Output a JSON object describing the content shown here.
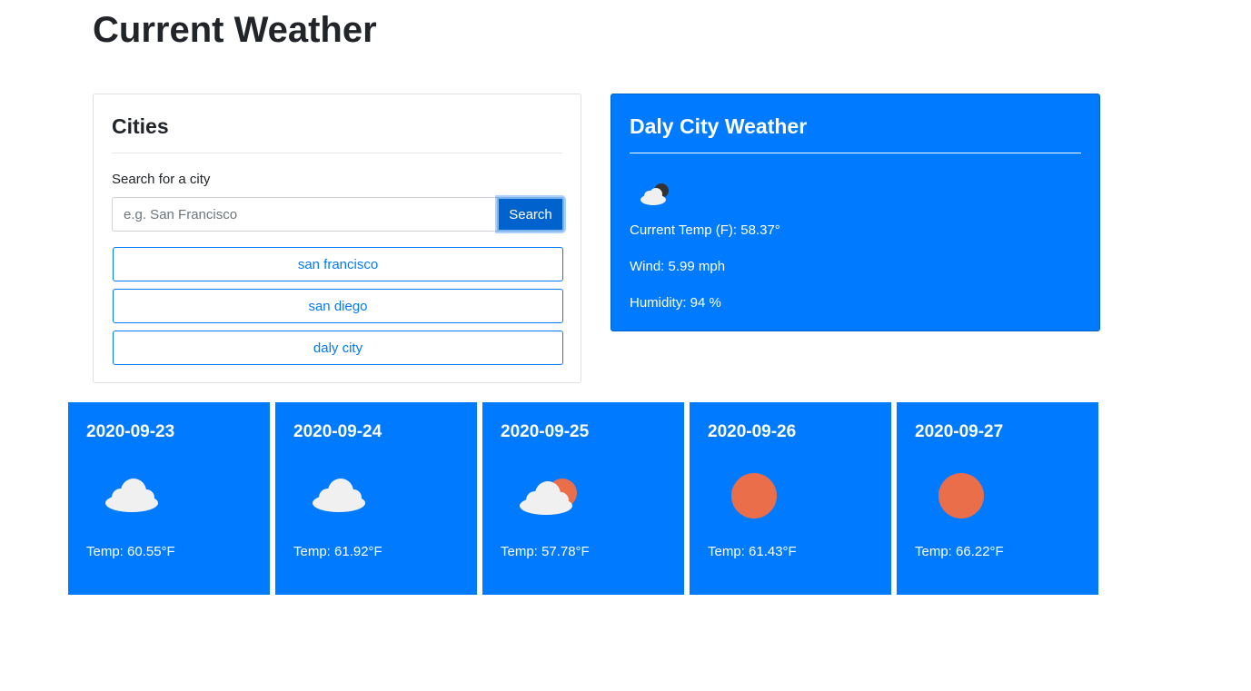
{
  "page": {
    "title": "Current Weather"
  },
  "cities": {
    "title": "Cities",
    "search_label": "Search for a city",
    "search_placeholder": "e.g. San Francisco",
    "search_value": "",
    "search_button": "Search",
    "items": [
      {
        "label": "san francisco"
      },
      {
        "label": "san diego"
      },
      {
        "label": "daly city"
      }
    ]
  },
  "current": {
    "title": "Daly City Weather",
    "icon": "night-partly-cloudy-icon",
    "temp": "Current Temp (F): 58.37°",
    "wind": "Wind: 5.99 mph",
    "humidity": "Humidity: 94 %"
  },
  "forecast": [
    {
      "date": "2020-09-23",
      "icon": "cloud-icon",
      "temp": "Temp: 60.55°F"
    },
    {
      "date": "2020-09-24",
      "icon": "cloud-icon",
      "temp": "Temp: 61.92°F"
    },
    {
      "date": "2020-09-25",
      "icon": "partly-cloudy-icon",
      "temp": "Temp: 57.78°F"
    },
    {
      "date": "2020-09-26",
      "icon": "sun-icon",
      "temp": "Temp: 61.43°F"
    },
    {
      "date": "2020-09-27",
      "icon": "sun-icon",
      "temp": "Temp: 66.22°F"
    }
  ],
  "colors": {
    "primary": "#007bff",
    "sun": "#eb6e4b",
    "cloud": "#f0f0f0"
  }
}
